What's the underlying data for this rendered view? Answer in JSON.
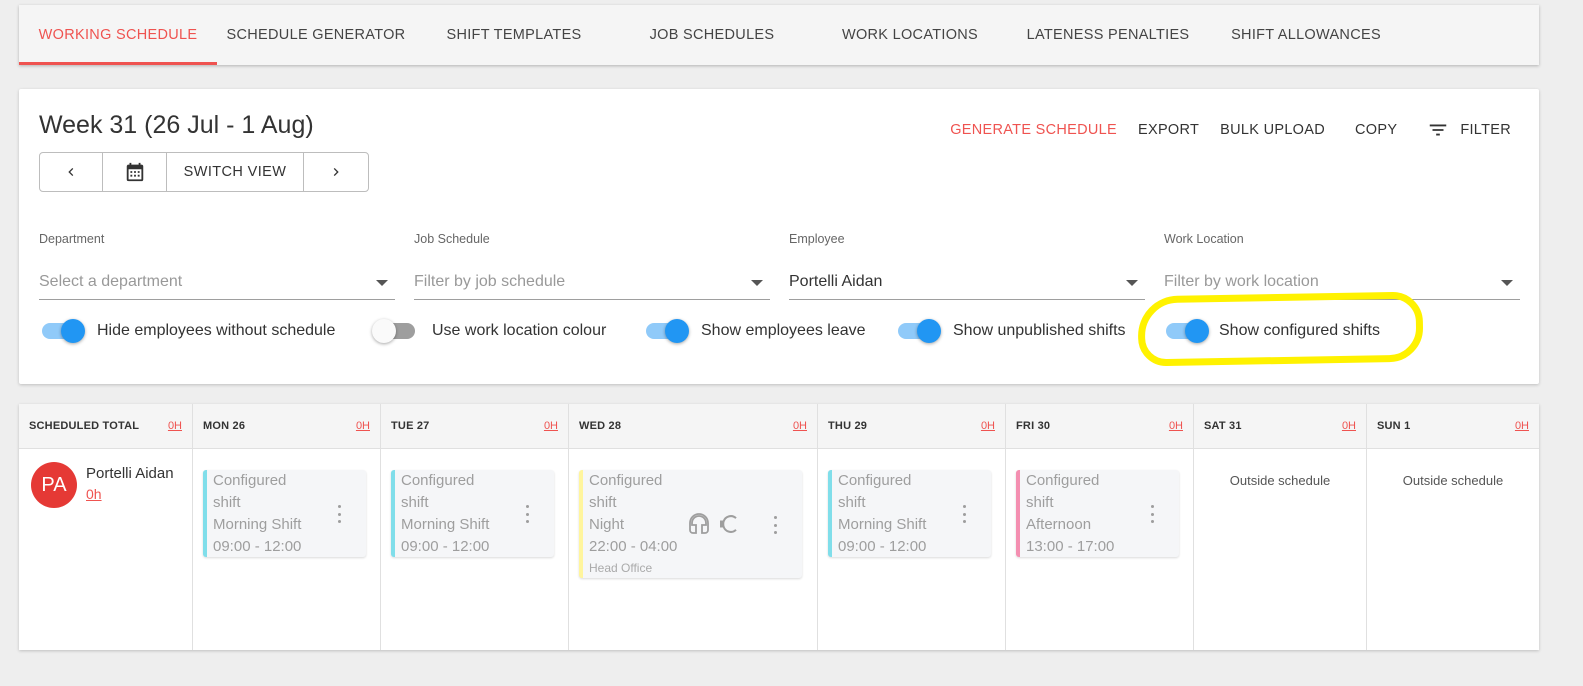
{
  "tabs": [
    {
      "label": "WORKING SCHEDULE",
      "active": true
    },
    {
      "label": "SCHEDULE GENERATOR"
    },
    {
      "label": "SHIFT TEMPLATES"
    },
    {
      "label": "JOB SCHEDULES"
    },
    {
      "label": "WORK LOCATIONS"
    },
    {
      "label": "LATENESS PENALTIES"
    },
    {
      "label": "SHIFT ALLOWANCES"
    }
  ],
  "header": {
    "week_title": "Week 31 (26 Jul - 1 Aug)",
    "switch_view": "SWITCH VIEW",
    "actions": {
      "generate": "GENERATE SCHEDULE",
      "export": "EXPORT",
      "bulk_upload": "BULK UPLOAD",
      "copy": "COPY",
      "filter": "FILTER"
    }
  },
  "filters": {
    "department": {
      "label": "Department",
      "placeholder": "Select a department"
    },
    "job_schedule": {
      "label": "Job Schedule",
      "placeholder": "Filter by job schedule"
    },
    "employee": {
      "label": "Employee",
      "value": "Portelli Aidan"
    },
    "work_location": {
      "label": "Work Location",
      "placeholder": "Filter by work location"
    }
  },
  "toggles": {
    "hide_without_schedule": {
      "label": "Hide employees without schedule",
      "on": true
    },
    "work_location_colour": {
      "label": "Use work location colour",
      "on": false
    },
    "employees_leave": {
      "label": "Show employees leave",
      "on": true
    },
    "unpublished_shifts": {
      "label": "Show unpublished shifts",
      "on": true
    },
    "configured_shifts": {
      "label": "Show configured shifts",
      "on": true
    }
  },
  "grid": {
    "columns": [
      {
        "title": "SCHEDULED TOTAL",
        "hours": "0H"
      },
      {
        "title": "MON 26",
        "hours": "0H"
      },
      {
        "title": "TUE 27",
        "hours": "0H"
      },
      {
        "title": "WED 28",
        "hours": "0H"
      },
      {
        "title": "THU 29",
        "hours": "0H"
      },
      {
        "title": "FRI 30",
        "hours": "0H"
      },
      {
        "title": "SAT 31",
        "hours": "0H"
      },
      {
        "title": "SUN 1",
        "hours": "0H"
      }
    ],
    "employee": {
      "initials": "PA",
      "name": "Portelli Aidan",
      "hours": "0h",
      "avatar_color": "#e53935"
    },
    "shifts": {
      "mon": {
        "line1": "Configured",
        "line2": "shift",
        "name": "Morning Shift",
        "time": "09:00 - 12:00",
        "color": "#80deea"
      },
      "tue": {
        "line1": "Configured",
        "line2": "shift",
        "name": "Morning Shift",
        "time": "09:00 - 12:00",
        "color": "#80deea"
      },
      "wed": {
        "line1": "Configured",
        "line2": "shift",
        "name": "Night",
        "time": "22:00 - 04:00",
        "location": "Head Office",
        "color": "#fff59d"
      },
      "thu": {
        "line1": "Configured",
        "line2": "shift",
        "name": "Morning Shift",
        "time": "09:00 - 12:00",
        "color": "#80deea"
      },
      "fri": {
        "line1": "Configured",
        "line2": "shift",
        "name": "Afternoon",
        "time": "13:00 - 17:00",
        "color": "#f48fb1"
      }
    },
    "outside_label": "Outside schedule",
    "icons": {
      "headset": "headset-icon",
      "euro": "euro-icon"
    }
  },
  "colors": {
    "accent": "#ef5350",
    "toggle": "#2196f3",
    "highlight": "#fff200"
  }
}
